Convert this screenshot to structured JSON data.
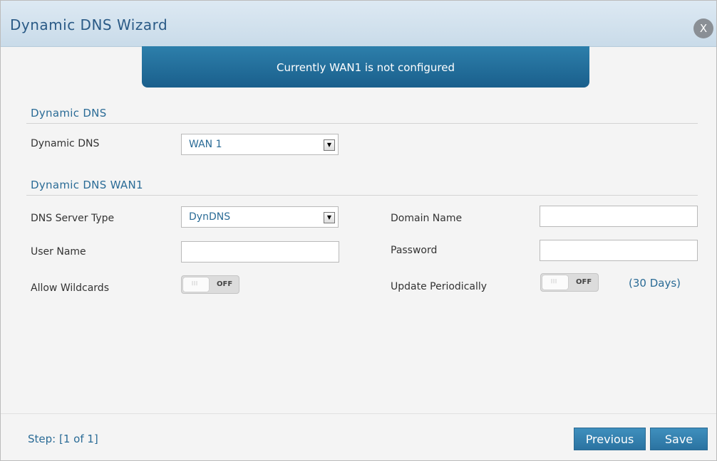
{
  "window": {
    "title": "Dynamic DNS Wizard",
    "close_label": "X"
  },
  "banner": {
    "text": "Currently WAN1 is not configured"
  },
  "section1": {
    "heading": "Dynamic DNS",
    "dynamic_dns_label": "Dynamic DNS",
    "dynamic_dns_value": "WAN 1"
  },
  "section2": {
    "heading": "Dynamic DNS WAN1",
    "dns_server_type_label": "DNS Server Type",
    "dns_server_type_value": "DynDNS",
    "domain_name_label": "Domain Name",
    "domain_name_value": "",
    "user_name_label": "User Name",
    "user_name_value": "",
    "password_label": "Password",
    "password_value": "",
    "allow_wildcards_label": "Allow Wildcards",
    "allow_wildcards_state": "OFF",
    "update_periodically_label": "Update Periodically",
    "update_periodically_state": "OFF",
    "update_period_text": "(30 Days)"
  },
  "footer": {
    "step_text": "Step: [1 of 1]",
    "previous_label": "Previous",
    "save_label": "Save"
  },
  "colors": {
    "accent": "#2a6b96",
    "banner": "#1a5f8c",
    "button": "#2b73a1"
  },
  "icons": {
    "close": "close-icon",
    "dropdown": "chevron-down-icon"
  }
}
